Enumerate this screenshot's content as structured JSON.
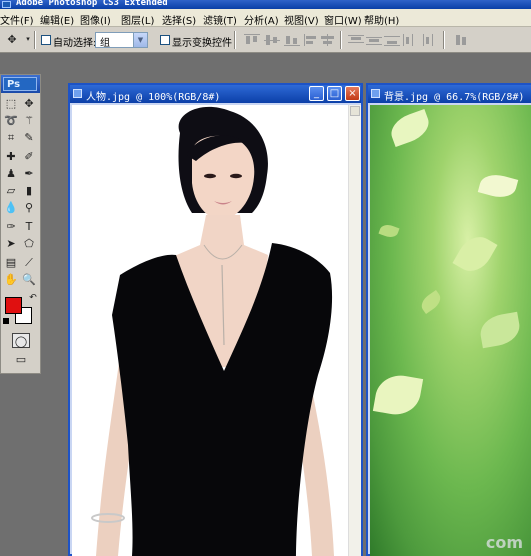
{
  "app": {
    "title": "Adobe Photoshop CS3 Extended"
  },
  "menu": [
    "文件(F)",
    "编辑(E)",
    "图像(I)",
    "图层(L)",
    "选择(S)",
    "滤镜(T)",
    "分析(A)",
    "视图(V)",
    "窗口(W)",
    "帮助(H)"
  ],
  "options": {
    "auto_select_label": "自动选择:",
    "auto_select_value": "组",
    "show_transform_label": "显示变换控件"
  },
  "toolbox": {
    "logo": "Ps"
  },
  "documents": [
    {
      "title": "人物.jpg @ 100%(RGB/8#)"
    },
    {
      "title": "背景.jpg @ 66.7%(RGB/8#)"
    }
  ],
  "colors": {
    "foreground": "#e01010",
    "background": "#ffffff",
    "titlebar": "#0b3fa8"
  },
  "watermark": "com"
}
